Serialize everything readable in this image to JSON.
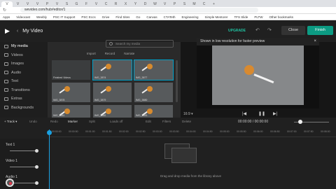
{
  "browser": {
    "tab_labels": [
      "V",
      "V",
      "V",
      "V",
      "P",
      "V",
      "S",
      "G",
      "F",
      "V",
      "C",
      "R",
      "X",
      "Y",
      "D",
      "W",
      "V",
      "P",
      "S",
      "M",
      "C",
      "+"
    ],
    "url": "wevideo.com/hub#editor/1",
    "bookmarks": [
      "Apps",
      "Videocast",
      "Weebly",
      "PSC IT Support",
      "PSC Eccs",
      "Grive",
      "Find Sites",
      "Go",
      "Canvas",
      "CTATeth",
      "Engineering",
      "Simple Mentorer",
      "TFS Slide",
      "PLTW",
      "Other bookmarks"
    ]
  },
  "app": {
    "logo": "▶",
    "back": "‹",
    "title": "My Video",
    "upgrade": "UPGRADE",
    "undo": "↶",
    "redo": "↷",
    "close": "Close",
    "finish": "Finish"
  },
  "sidebar": {
    "items": [
      {
        "label": "My media"
      },
      {
        "label": "Videos"
      },
      {
        "label": "Images"
      },
      {
        "label": "Audio"
      },
      {
        "label": "Text"
      },
      {
        "label": "Transitions"
      },
      {
        "label": "Extras"
      },
      {
        "label": "Backgrounds"
      }
    ]
  },
  "library": {
    "search_placeholder": "Search my media",
    "import": "Import",
    "record": "Record",
    "narrate": "Narrate",
    "thumbs": [
      {
        "caption": "Finished Videos"
      },
      {
        "caption": "IMG_3874"
      },
      {
        "caption": "IMG_3877"
      },
      {
        "caption": "IMG_3878"
      },
      {
        "caption": "IMG_3879"
      },
      {
        "caption": "IMG_3880"
      },
      {
        "caption": "IMG_3881"
      },
      {
        "caption": "IMG_3882"
      },
      {
        "caption": "IMG_3883"
      }
    ]
  },
  "preview": {
    "banner": "Shown in low resolution for faster preview",
    "close": "×",
    "ratio": "16:9 ▾",
    "prev": "|◀",
    "play": "❚❚",
    "next": "▶|"
  },
  "timeline": {
    "track_button": "+ Track ▾",
    "tools": [
      "Undo",
      "Redo",
      "Marker",
      "Split",
      "Loads off",
      "Edit",
      "Filters",
      "Delete"
    ],
    "time": "00:00:00 / 00:00:00",
    "ruler": [
      "00:00:00",
      "00:00:50",
      "00:01:00",
      "00:01:50",
      "00:02:00",
      "00:02:50",
      "00:03:00",
      "00:03:50",
      "00:04:00",
      "00:04:50",
      "00:05:00",
      "00:05:50",
      "00:06:00",
      "00:06:50",
      "00:07:00",
      "00:07:50",
      "00:08:00"
    ],
    "tracks": [
      {
        "label": "Text 1"
      },
      {
        "label": "Video 1"
      },
      {
        "label": "Audio 1"
      }
    ],
    "drop_text": "Drag and drop media from the library above"
  }
}
